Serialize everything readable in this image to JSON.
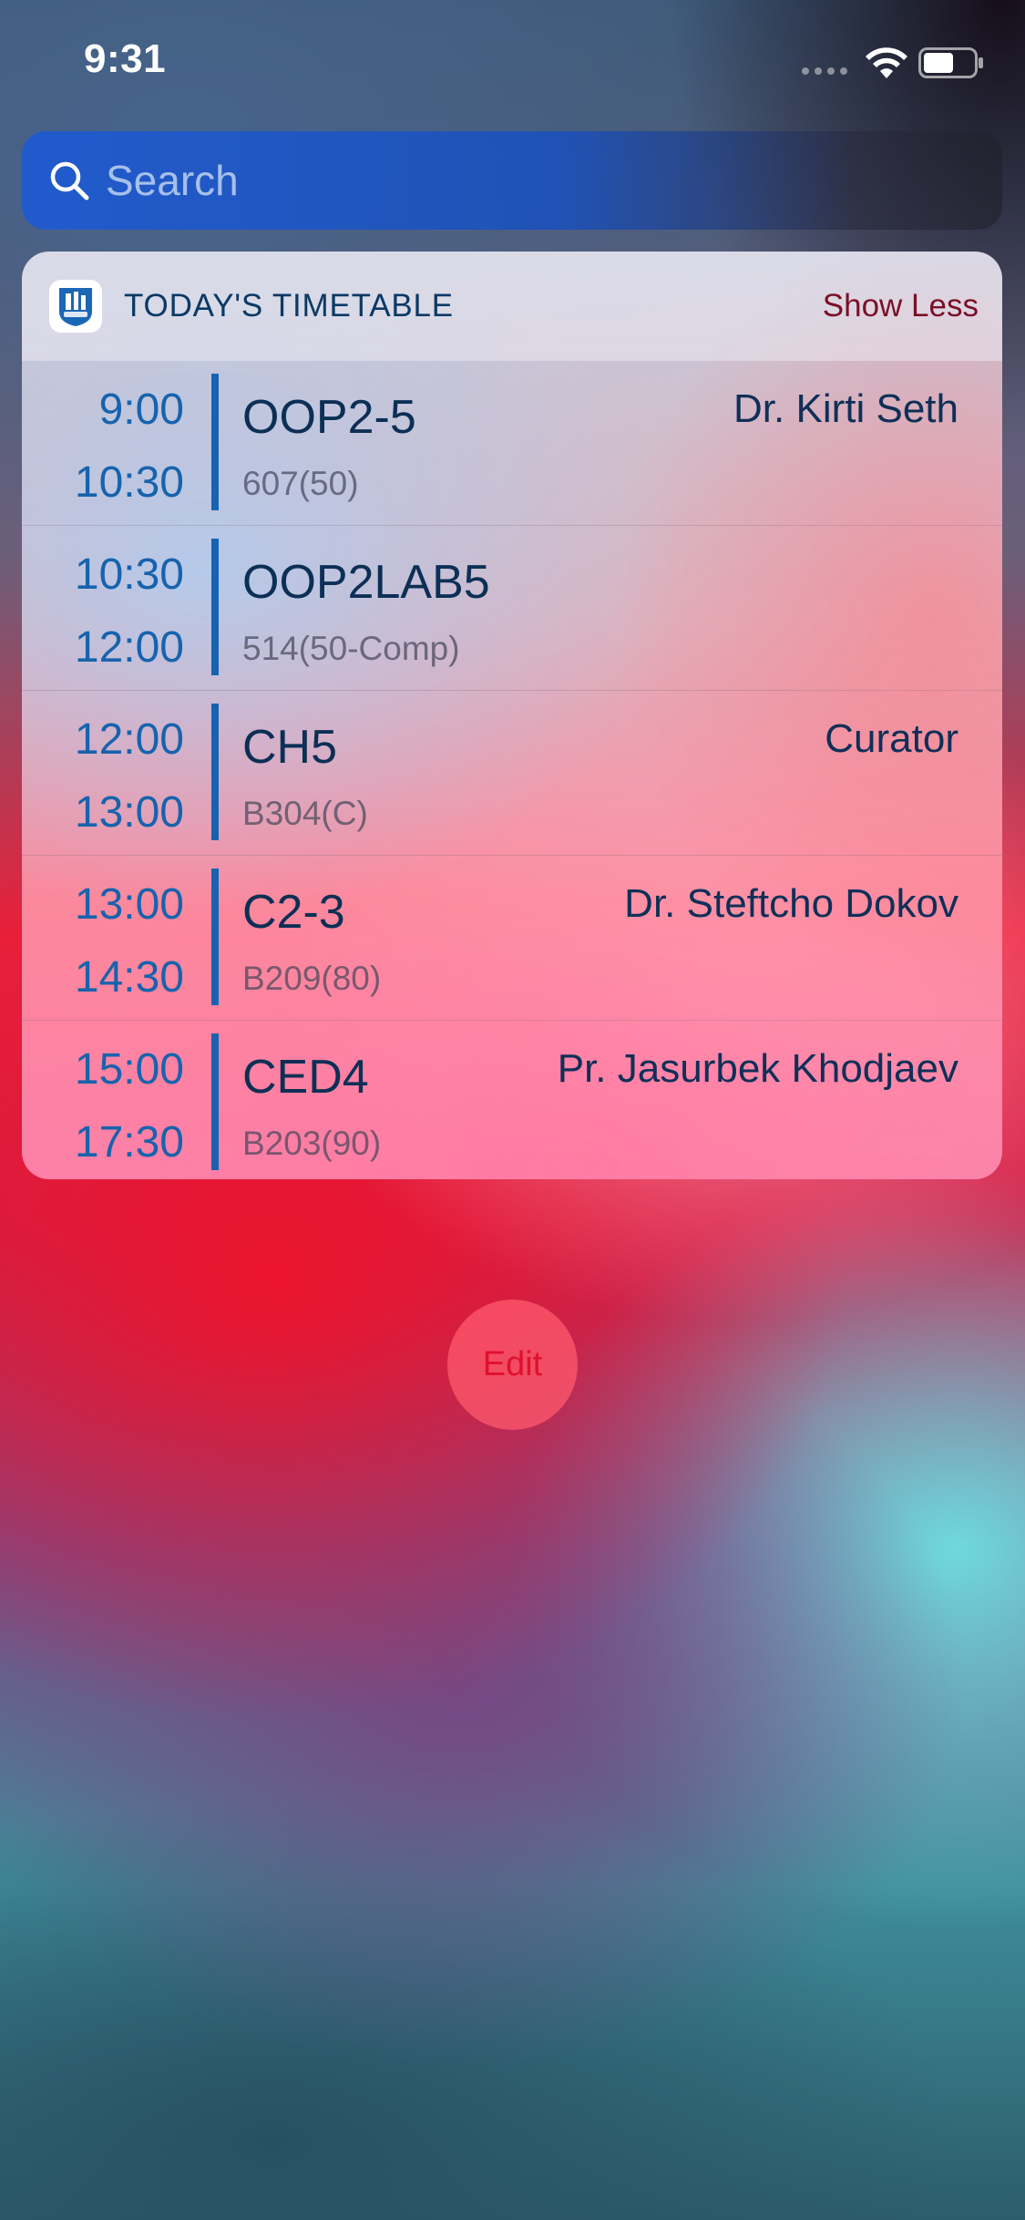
{
  "status_bar": {
    "time": "9:31",
    "signal_icon": "signal-dots-icon",
    "wifi_icon": "wifi-icon",
    "battery_icon": "battery-icon",
    "battery_level": 0.55
  },
  "search": {
    "placeholder": "Search",
    "icon": "magnifier-icon"
  },
  "widget": {
    "title": "TODAY'S TIMETABLE",
    "toggle_label": "Show Less",
    "app_icon": "university-shield-icon",
    "accent_color": "#1863b1",
    "classes": [
      {
        "start": "9:00",
        "end": "10:30",
        "course": "OOP2-5",
        "room": "607(50)",
        "teacher": "Dr. Kirti Seth"
      },
      {
        "start": "10:30",
        "end": "12:00",
        "course": "OOP2LAB5",
        "room": "514(50-Comp)",
        "teacher": ""
      },
      {
        "start": "12:00",
        "end": "13:00",
        "course": "CH5",
        "room": "B304(C)",
        "teacher": "Curator"
      },
      {
        "start": "13:00",
        "end": "14:30",
        "course": "C2-3",
        "room": "B209(80)",
        "teacher": "Dr. Steftcho Dokov"
      },
      {
        "start": "15:00",
        "end": "17:30",
        "course": "CED4",
        "room": "B203(90)",
        "teacher": "Pr. Jasurbek Khodjaev"
      }
    ]
  },
  "edit_button": {
    "label": "Edit",
    "color": "#e0102e"
  }
}
